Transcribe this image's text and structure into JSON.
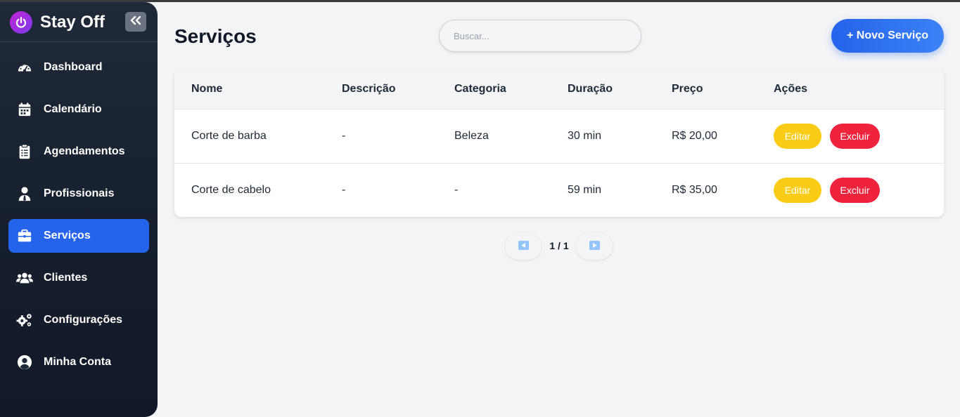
{
  "app": {
    "name": "Stay Off",
    "accent": "#2563eb",
    "brand_gradient": [
      "#c026d3",
      "#7c3aed"
    ]
  },
  "sidebar": {
    "items": [
      {
        "label": "Dashboard",
        "icon": "gauge-icon"
      },
      {
        "label": "Calendário",
        "icon": "calendar-icon"
      },
      {
        "label": "Agendamentos",
        "icon": "clipboard-icon"
      },
      {
        "label": "Profissionais",
        "icon": "user-tie-icon"
      },
      {
        "label": "Serviços",
        "icon": "briefcase-icon",
        "active": true
      },
      {
        "label": "Clientes",
        "icon": "users-icon"
      },
      {
        "label": "Configurações",
        "icon": "gears-icon"
      },
      {
        "label": "Minha Conta",
        "icon": "user-circle-icon"
      }
    ]
  },
  "page": {
    "title": "Serviços"
  },
  "search": {
    "placeholder": "Buscar...",
    "value": ""
  },
  "actions": {
    "new_label": "+ Novo Serviço"
  },
  "table": {
    "headers": [
      "Nome",
      "Descrição",
      "Categoria",
      "Duração",
      "Preço",
      "Ações"
    ],
    "rows": [
      {
        "nome": "Corte de barba",
        "descricao": "-",
        "categoria": "Beleza",
        "duracao": "30 min",
        "preco": "R$ 20,00"
      },
      {
        "nome": "Corte de cabelo",
        "descricao": "-",
        "categoria": "-",
        "duracao": "59 min",
        "preco": "R$ 35,00"
      }
    ],
    "edit_label": "Editar",
    "delete_label": "Excluir",
    "edit_color": "#facc15",
    "delete_color": "#ef233c"
  },
  "pagination": {
    "text": "1 / 1"
  }
}
